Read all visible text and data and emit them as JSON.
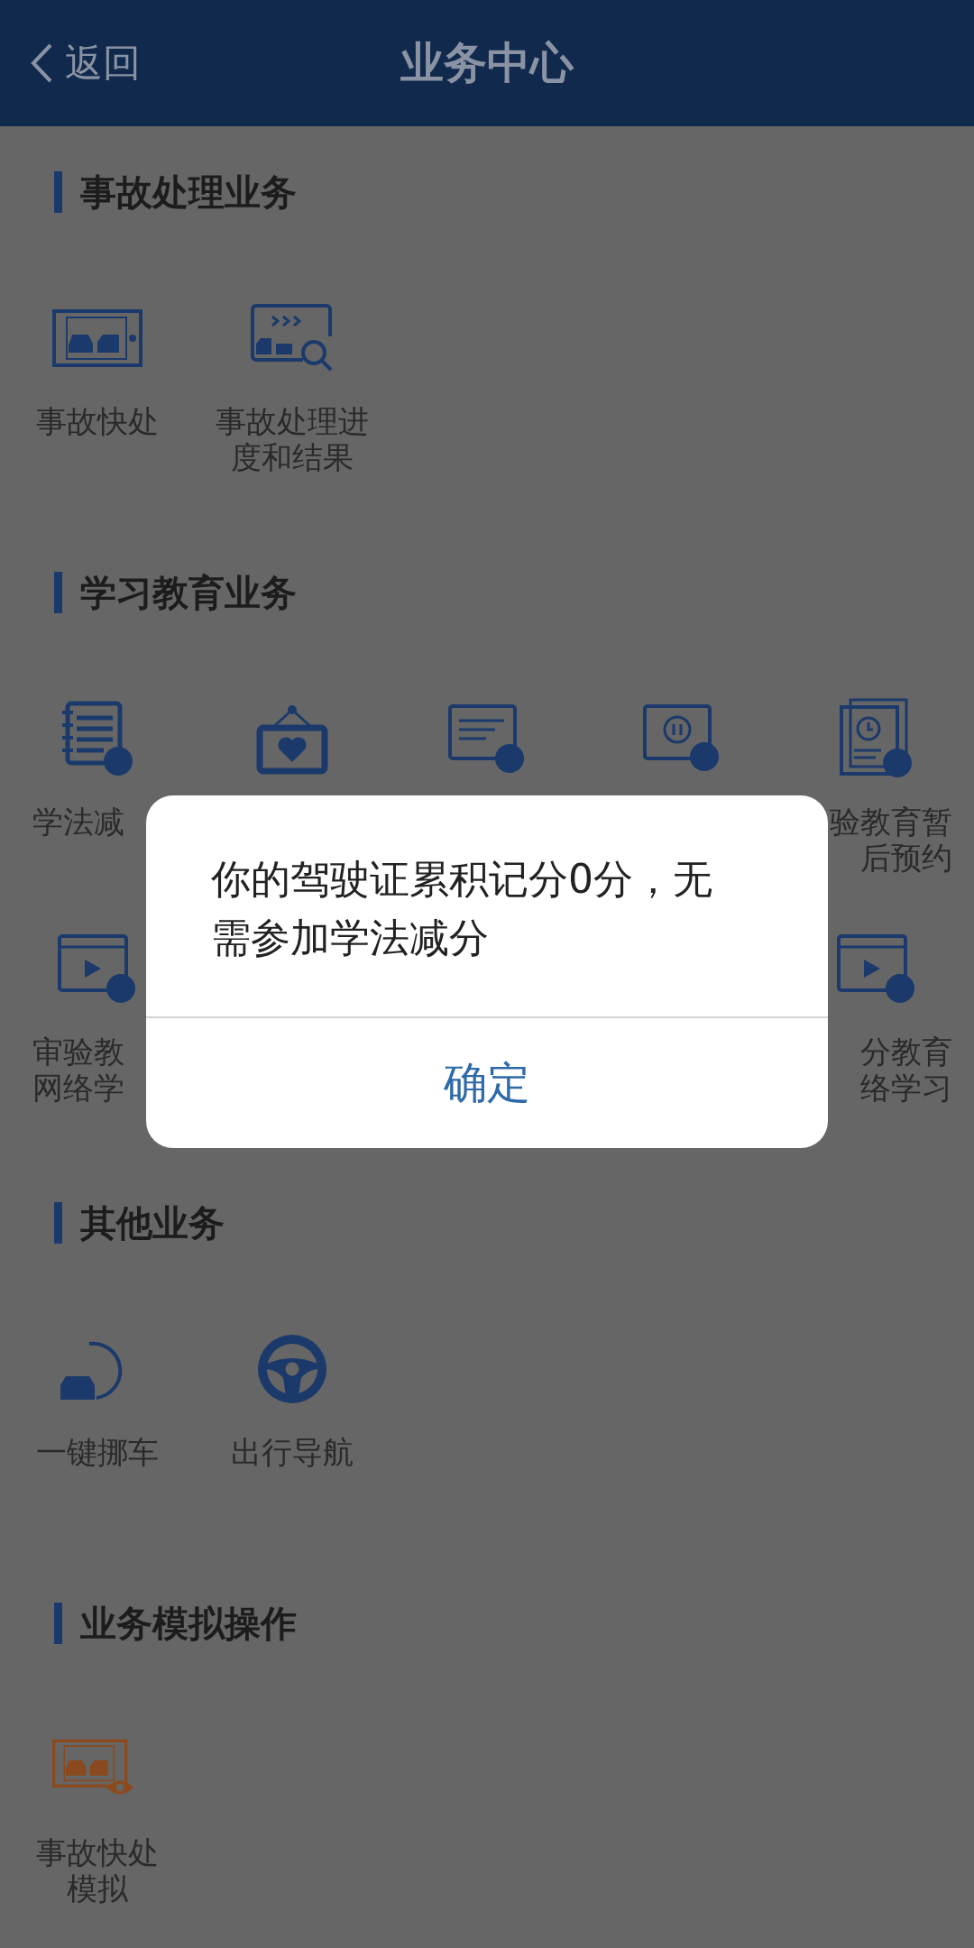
{
  "header": {
    "back": "返回",
    "title": "业务中心"
  },
  "sections": [
    {
      "title": "事故处理业务",
      "items": [
        {
          "label": [
            "事故快处"
          ]
        },
        {
          "label": [
            "事故处理进",
            "度和结果"
          ]
        }
      ]
    },
    {
      "title": "学习教育业务",
      "rows": [
        [
          {
            "kind": "tile",
            "label": [
              "学法减"
            ]
          },
          {
            "kind": "icon"
          },
          {
            "kind": "icon"
          },
          {
            "kind": "icon"
          },
          {
            "kind": "tile",
            "label": [
              "验教育暂",
              "后预约"
            ]
          }
        ],
        [
          {
            "kind": "tile",
            "label": [
              "审验教",
              "网络学"
            ]
          },
          {
            "kind": "tile",
            "label": [
              "分教育",
              "络学习"
            ]
          }
        ]
      ]
    },
    {
      "title": "其他业务",
      "items": [
        {
          "label": [
            "一键挪车"
          ]
        },
        {
          "label": [
            "出行导航"
          ]
        }
      ]
    },
    {
      "title": "业务模拟操作",
      "items": [
        {
          "label": [
            "事故快处",
            "模拟"
          ]
        }
      ]
    }
  ],
  "dialog": {
    "message": "你的驾驶证累积记分0分，无需参加学法减分",
    "button": "确定"
  }
}
